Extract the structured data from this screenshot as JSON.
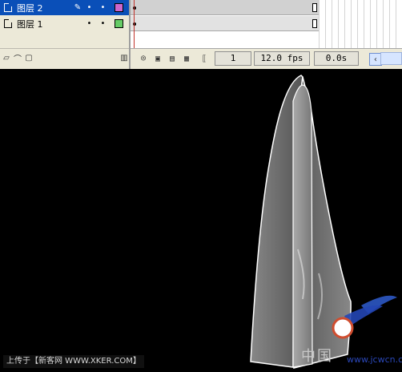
{
  "timeline": {
    "layers": [
      {
        "name": "图层 2",
        "selected": true,
        "color": "#cc66cc"
      },
      {
        "name": "图层 1",
        "selected": false,
        "color": "#66cc66"
      }
    ],
    "status": {
      "frame": "1",
      "fps": "12.0 fps",
      "time": "0.0s"
    }
  },
  "icons": {
    "layer": "layer-icon",
    "pencil": "pencil-icon",
    "visibility": "dot-icon",
    "lock": "dot-icon",
    "trash": "trash-icon"
  },
  "watermarks": {
    "left": "上传于【新客网 WWW.XKER.COM】",
    "right": "中国",
    "url": "www.jcwcn.com"
  }
}
